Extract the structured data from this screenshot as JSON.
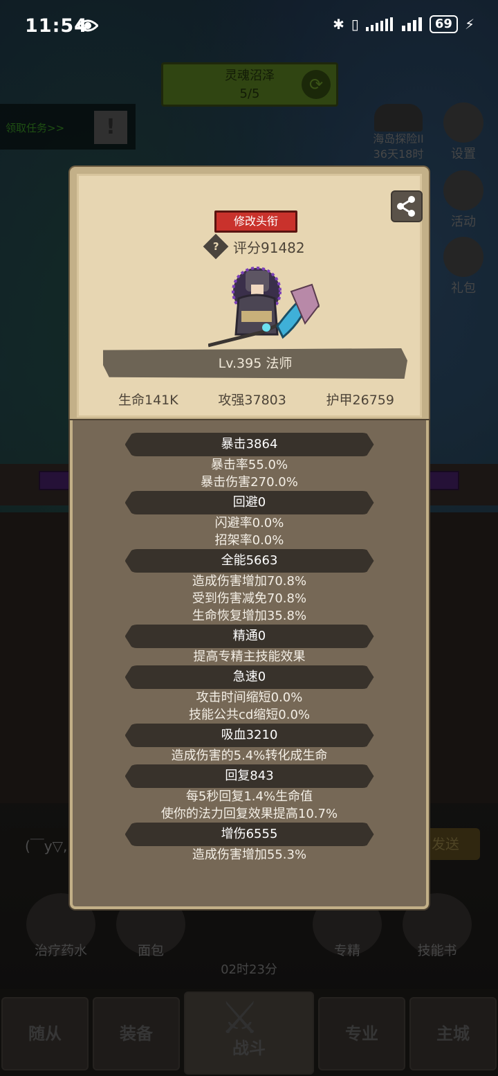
{
  "status_bar": {
    "time": "11:54",
    "battery": "69"
  },
  "background": {
    "zone_name": "灵魂沼泽",
    "zone_progress": "5/5",
    "quest_label": "领取任务>>",
    "expedition_title": "海岛探险II",
    "expedition_timer": "36天18时",
    "side_buttons": [
      "设置",
      "活动",
      "礼包"
    ],
    "chat_placeholder": "(￣y▽,",
    "chat_send": "发送",
    "tools": [
      "治疗药水",
      "面包",
      "专精",
      "技能书"
    ],
    "chest_timer": "02时23分",
    "nav_tabs": [
      "随从",
      "装备",
      "战斗",
      "专业",
      "主城"
    ]
  },
  "modal": {
    "rename_label": "修改头衔",
    "score": "评分91482",
    "level_class": "Lv.395 法师",
    "hp": "生命141K",
    "attack": "攻强37803",
    "armor": "护甲26759",
    "attributes": [
      {
        "title": "暴击3864",
        "lines": [
          "暴击率55.0%",
          "暴击伤害270.0%"
        ]
      },
      {
        "title": "回避0",
        "lines": [
          "闪避率0.0%",
          "招架率0.0%"
        ]
      },
      {
        "title": "全能5663",
        "lines": [
          "造成伤害增加70.8%",
          "受到伤害减免70.8%",
          "生命恢复增加35.8%"
        ]
      },
      {
        "title": "精通0",
        "lines": [
          "提高专精主技能效果"
        ]
      },
      {
        "title": "急速0",
        "lines": [
          "攻击时间缩短0.0%",
          "技能公共cd缩短0.0%"
        ]
      },
      {
        "title": "吸血3210",
        "lines": [
          "造成伤害的5.4%转化成生命"
        ]
      },
      {
        "title": "回复843",
        "lines": [
          "每5秒回复1.4%生命值",
          "使你的法力回复效果提高10.7%"
        ]
      },
      {
        "title": "增伤6555",
        "lines": [
          "造成伤害增加55.3%"
        ]
      }
    ]
  }
}
